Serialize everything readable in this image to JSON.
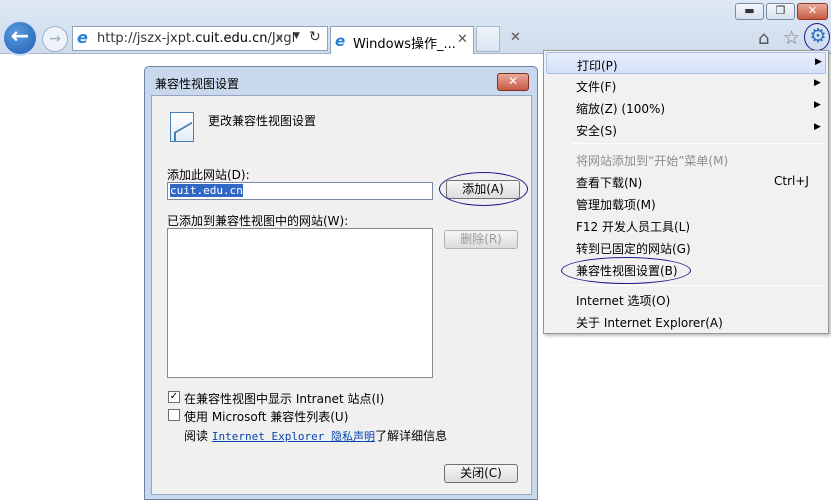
{
  "window": {
    "min_glyph": "▬",
    "max_glyph": "❐",
    "close_glyph": "✕"
  },
  "toolbar": {
    "back_glyph": "←",
    "forward_glyph": "→",
    "address_prefix": "http://jszx-jxpt.",
    "address_domain": "cuit.edu.cn",
    "address_suffix": "/Jxgl",
    "search_glyph": "⌕",
    "dropdown_glyph": "▼",
    "refresh_glyph": "↻",
    "home_glyph": "⌂",
    "favorites_glyph": "☆",
    "tools_glyph": "⚙"
  },
  "tabs": {
    "active_title": "Windows操作_...",
    "close_glyph": "✕"
  },
  "tools_menu": {
    "items": [
      {
        "label": "打印(P)",
        "submenu": true
      },
      {
        "label": "文件(F)",
        "submenu": true
      },
      {
        "label": "缩放(Z) (100%)",
        "submenu": true
      },
      {
        "label": "安全(S)",
        "submenu": true
      },
      {
        "label": "将网站添加到“开始”菜单(M)"
      },
      {
        "label": "查看下载(N)",
        "shortcut": "Ctrl+J"
      },
      {
        "label": "管理加载项(M)"
      },
      {
        "label": "F12 开发人员工具(L)"
      },
      {
        "label": "转到已固定的网站(G)"
      },
      {
        "label": "兼容性视图设置(B)"
      },
      {
        "label": "Internet 选项(O)"
      },
      {
        "label": "关于 Internet Explorer(A)"
      }
    ],
    "submenu_glyph": "▶"
  },
  "dialog": {
    "title": "兼容性视图设置",
    "heading": "更改兼容性视图设置",
    "add_site_label": "添加此网站(D):",
    "add_site_value": "cuit.edu.cn",
    "add_button": "添加(A)",
    "added_sites_label": "已添加到兼容性视图中的网站(W):",
    "remove_button": "删除(R)",
    "intranet_checkbox": "在兼容性视图中显示 Intranet 站点(I)",
    "intranet_checked": true,
    "ms_list_checkbox": "使用 Microsoft 兼容性列表(U)",
    "ms_list_checked": false,
    "read_prefix": "阅读",
    "privacy_link": "Internet Explorer 隐私声明",
    "read_suffix": "了解详细信息",
    "close_button": "关闭(C)",
    "close_glyph": "✕",
    "check_glyph": "✓"
  }
}
